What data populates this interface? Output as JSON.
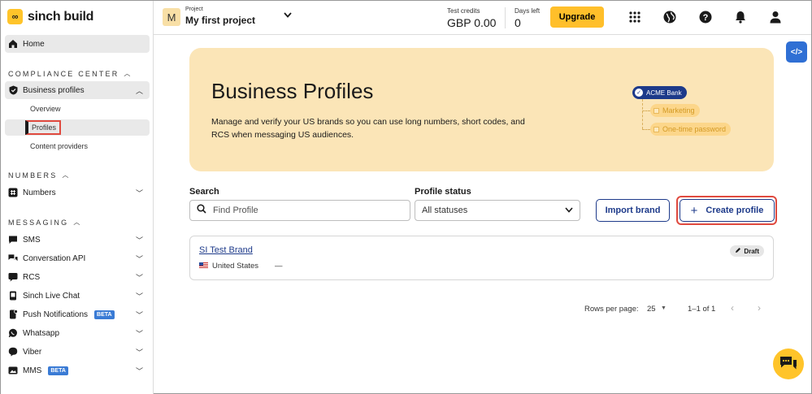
{
  "app": {
    "logo_text": "sinch build"
  },
  "sidebar": {
    "home": "Home",
    "compliance_title": "COMPLIANCE CENTER",
    "business_profiles": "Business profiles",
    "sub": [
      "Overview",
      "Profiles",
      "Content providers"
    ],
    "numbers_title": "NUMBERS",
    "numbers": "Numbers",
    "messaging_title": "MESSAGING",
    "messaging": [
      "SMS",
      "Conversation API",
      "RCS",
      "Sinch Live Chat",
      "Push Notifications",
      "Whatsapp",
      "Viber",
      "MMS"
    ],
    "beta": "BETA"
  },
  "topbar": {
    "project_initial": "M",
    "project_label": "Project",
    "project_name": "My first project",
    "credits_label": "Test credits",
    "credits_value": "GBP 0.00",
    "days_label": "Days left",
    "days_value": "0",
    "upgrade": "Upgrade"
  },
  "banner": {
    "title": "Business Profiles",
    "description": "Manage and verify your US brands so you can use long numbers, short codes, and RCS when messaging US audiences.",
    "acme": "ACME Bank",
    "tag1": "Marketing",
    "tag2": "One-time password"
  },
  "filters": {
    "search_label": "Search",
    "search_placeholder": "Find Profile",
    "status_label": "Profile status",
    "status_value": "All statuses",
    "import": "Import brand",
    "create": "Create profile"
  },
  "profiles": [
    {
      "name": "SI Test Brand",
      "country": "United States",
      "extra": "—",
      "status": "Draft"
    }
  ],
  "pagination": {
    "rows_label": "Rows per page:",
    "rows_value": "25",
    "range": "1–1 of 1"
  },
  "colors": {
    "accent_yellow": "#ffbf2a",
    "primary_blue": "#1d3a8a",
    "highlight_red": "#e04a3f",
    "banner_bg": "#fbe5b7"
  }
}
